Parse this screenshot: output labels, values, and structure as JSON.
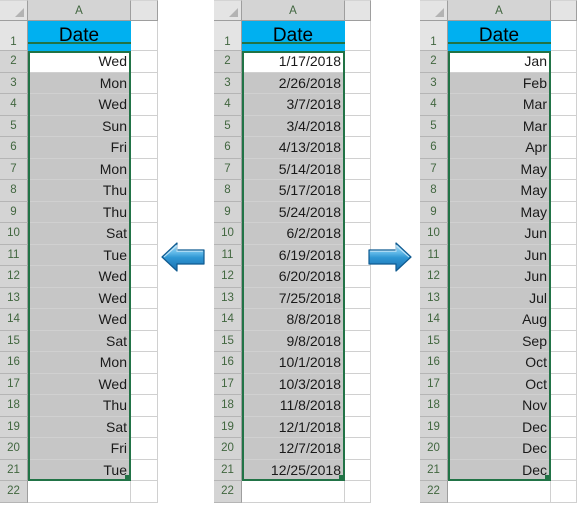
{
  "app": {
    "kind": "spreadsheet-comparison",
    "accent_green": "#217346",
    "header_fill": "#00b0f0",
    "selected_fill": "#c6c6c6",
    "arrow_blue": "#3f9fd8"
  },
  "column_header": {
    "corner_label": "",
    "column_a": "A",
    "column_b": ""
  },
  "row_numbers": [
    "1",
    "2",
    "3",
    "4",
    "5",
    "6",
    "7",
    "8",
    "9",
    "10",
    "11",
    "12",
    "13",
    "14",
    "15",
    "16",
    "17",
    "18",
    "19",
    "20",
    "21",
    "22"
  ],
  "panels": [
    {
      "id": "weekday-panel",
      "name": "weekday-result-sheet",
      "header": "Date",
      "values": [
        "Wed",
        "Mon",
        "Wed",
        "Sun",
        "Fri",
        "Mon",
        "Thu",
        "Thu",
        "Sat",
        "Tue",
        "Wed",
        "Wed",
        "Wed",
        "Sat",
        "Mon",
        "Wed",
        "Thu",
        "Sat",
        "Fri",
        "Tue"
      ]
    },
    {
      "id": "date-panel",
      "name": "source-date-sheet",
      "header": "Date",
      "values": [
        "1/17/2018",
        "2/26/2018",
        "3/7/2018",
        "3/4/2018",
        "4/13/2018",
        "5/14/2018",
        "5/17/2018",
        "5/24/2018",
        "6/2/2018",
        "6/19/2018",
        "6/20/2018",
        "7/25/2018",
        "8/8/2018",
        "9/8/2018",
        "10/1/2018",
        "10/3/2018",
        "11/8/2018",
        "12/1/2018",
        "12/7/2018",
        "12/25/2018"
      ]
    },
    {
      "id": "month-panel",
      "name": "month-result-sheet",
      "header": "Date",
      "values": [
        "Jan",
        "Feb",
        "Mar",
        "Mar",
        "Apr",
        "May",
        "May",
        "May",
        "Jun",
        "Jun",
        "Jun",
        "Jul",
        "Aug",
        "Sep",
        "Oct",
        "Oct",
        "Nov",
        "Dec",
        "Dec",
        "Dec"
      ]
    }
  ],
  "arrows": [
    {
      "name": "arrow-left",
      "direction": "left"
    },
    {
      "name": "arrow-right",
      "direction": "right"
    }
  ]
}
